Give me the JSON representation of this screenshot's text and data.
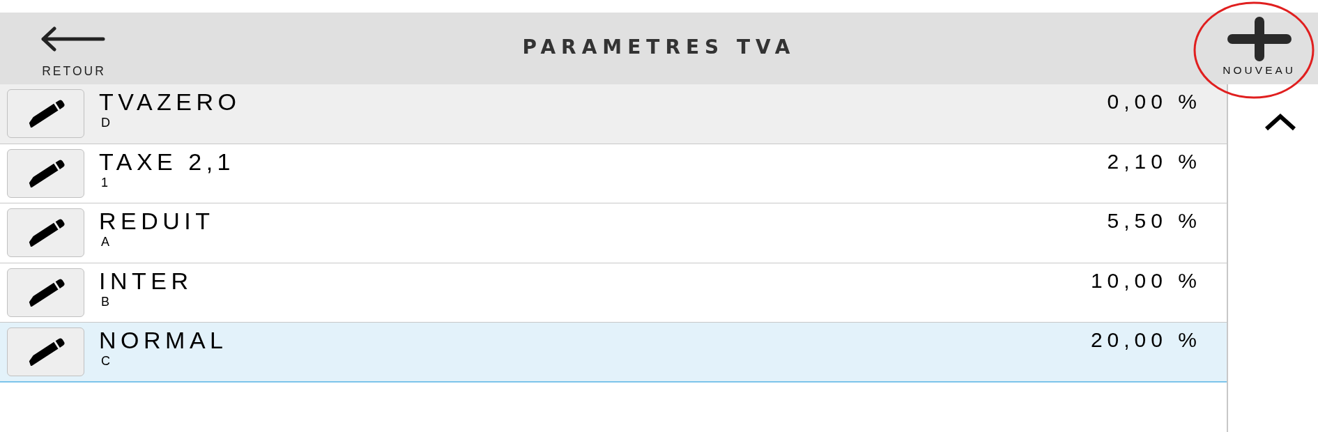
{
  "header": {
    "back_button": {
      "label": "RETOUR"
    },
    "title": "PARAMETRES TVA",
    "new_button": {
      "label": "NOUVEAU",
      "highlighted": true
    }
  },
  "vat_rates": [
    {
      "name": "TVAZERO",
      "code": "D",
      "rate": "0,00 %",
      "hovered": true,
      "selected": false
    },
    {
      "name": "TAXE 2,1",
      "code": "1",
      "rate": "2,10 %",
      "hovered": false,
      "selected": false
    },
    {
      "name": "REDUIT",
      "code": "A",
      "rate": "5,50 %",
      "hovered": false,
      "selected": false
    },
    {
      "name": "INTER",
      "code": "B",
      "rate": "10,00 %",
      "hovered": false,
      "selected": false
    },
    {
      "name": "NORMAL",
      "code": "C",
      "rate": "20,00 %",
      "hovered": false,
      "selected": true
    }
  ]
}
